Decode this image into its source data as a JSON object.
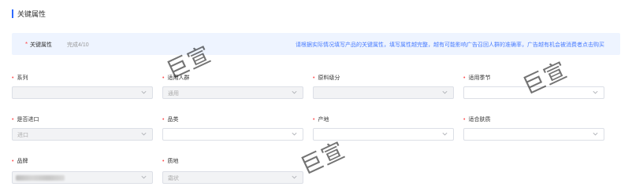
{
  "section": {
    "title": "关键属性",
    "accent_color": "#2f6bff"
  },
  "banner": {
    "required_mark": "*",
    "label": "关键属性",
    "progress": "完成4/10",
    "hint": "请根据实际情况填写产品的关键属性，填写属性越完整，越有可能影响广告召回人群的准确率，广告越有机会被消费者点击购买"
  },
  "fields": [
    {
      "label": "系列",
      "value": ""
    },
    {
      "label": "适用人群",
      "value": "通用"
    },
    {
      "label": "原料级分",
      "value": ""
    },
    {
      "label": "适用季节",
      "value": ""
    },
    {
      "label": "是否进口",
      "value": "进口"
    },
    {
      "label": "品类",
      "value": ""
    },
    {
      "label": "产地",
      "value": ""
    },
    {
      "label": "适合肤质",
      "value": ""
    },
    {
      "label": "品牌",
      "value": ""
    },
    {
      "label": "质地",
      "value": "霜状"
    }
  ],
  "watermark": {
    "text": "巨宣"
  },
  "colors": {
    "required": "#ff4d4f",
    "hint": "#4a7dff",
    "banner_bg": "#eef4ff"
  },
  "icons": {
    "dropdown": "chevron-down-icon"
  }
}
